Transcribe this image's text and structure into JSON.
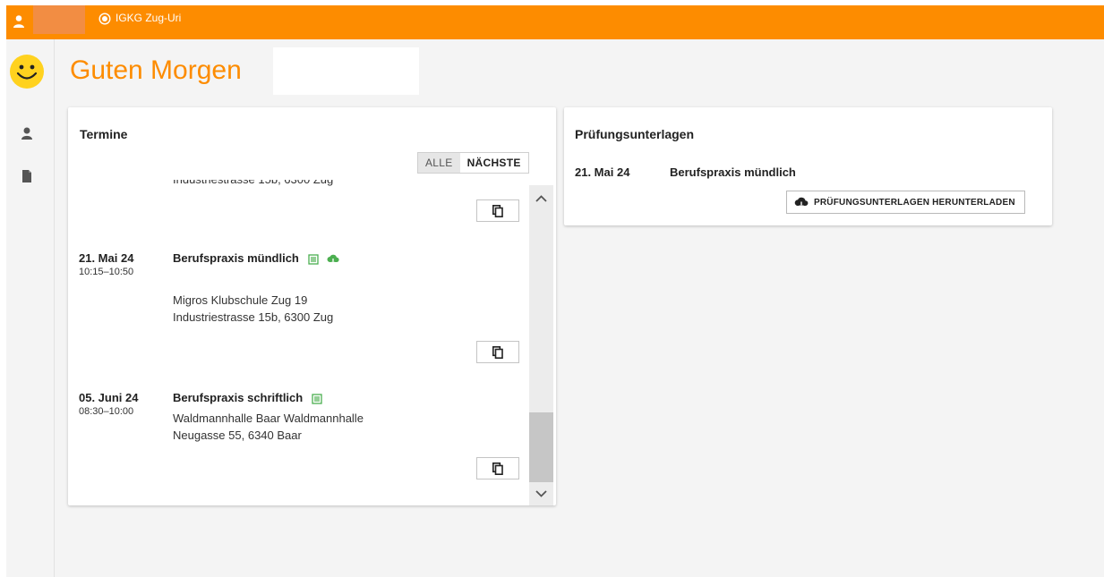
{
  "topbar": {
    "org_name": "IGKG Zug-Uri",
    "accent_color": "#fd8c00",
    "icons": [
      "user-icon",
      "org-radio-icon"
    ]
  },
  "greeting": {
    "text": "Guten Morgen"
  },
  "sidebar": {
    "items": [
      {
        "name": "profile",
        "icon": "person-icon"
      },
      {
        "name": "documents",
        "icon": "document-icon"
      }
    ]
  },
  "termine": {
    "title": "Termine",
    "filter": {
      "all_label": "ALLE",
      "next_label": "NÄCHSTE",
      "selected": "NÄCHSTE"
    },
    "entries": [
      {
        "date": "",
        "time": "",
        "title": "",
        "address_line1": "",
        "address_line2": "Industriestrasse 15b, 6300 Zug"
      },
      {
        "date": "21. Mai 24",
        "time": "10:15–10:50",
        "title": "Berufspraxis mündlich",
        "address_line1": "Migros Klubschule Zug 19",
        "address_line2": "Industriestrasse 15b, 6300 Zug"
      },
      {
        "date": "05. Juni 24",
        "time": "08:30–10:00",
        "title": "Berufspraxis schriftlich",
        "address_line1": "Waldmannhalle Baar Waldmannhalle",
        "address_line2": "Neugasse 55, 6340 Baar"
      }
    ]
  },
  "pruefungsunterlagen": {
    "title": "Prüfungsunterlagen",
    "item": {
      "date": "21. Mai 24",
      "title": "Berufspraxis mündlich"
    },
    "download_label": "PRÜFUNGSUNTERLAGEN HERUNTERLADEN"
  },
  "colors": {
    "green": "#4caf50",
    "orange": "#fd8c00",
    "smiley": "#ffd21f"
  }
}
